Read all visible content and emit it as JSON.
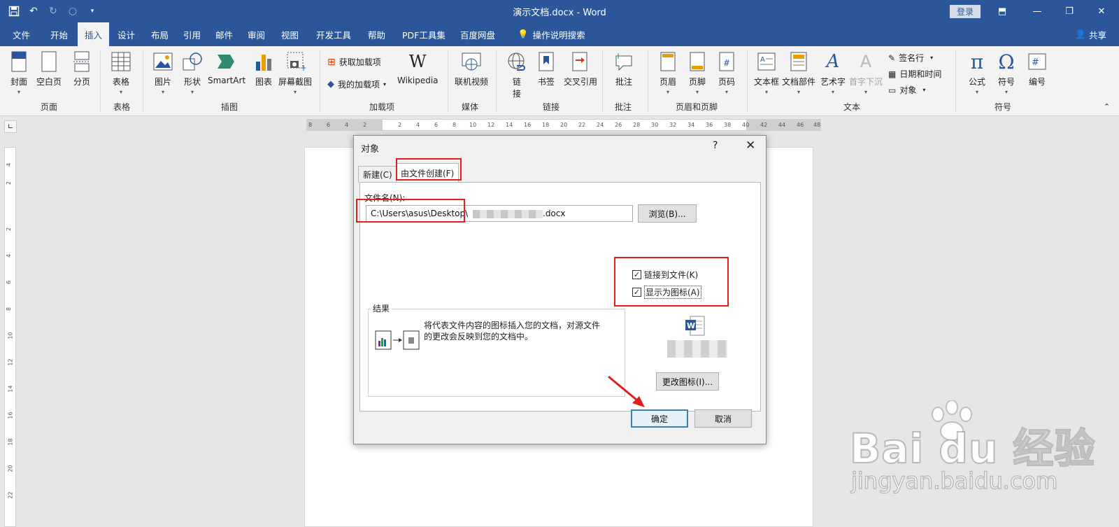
{
  "window": {
    "title": "演示文档.docx - Word",
    "login": "登录",
    "share": "共享"
  },
  "tabs": [
    "文件",
    "开始",
    "插入",
    "设计",
    "布局",
    "引用",
    "邮件",
    "审阅",
    "视图",
    "开发工具",
    "帮助",
    "PDF工具集",
    "百度网盘",
    "操作说明搜索"
  ],
  "active_tab": "插入",
  "ribbon": {
    "page": {
      "cover": "封面",
      "blank": "空白页",
      "break": "分页",
      "group": "页面"
    },
    "table": {
      "table": "表格",
      "group": "表格"
    },
    "illustrations": {
      "picture": "图片",
      "shapes": "形状",
      "smartart": "SmartArt",
      "chart": "图表",
      "screenshot": "屏幕截图",
      "group": "插图"
    },
    "addins": {
      "get": "获取加载项",
      "mine": "我的加载项",
      "wikipedia": "Wikipedia",
      "group": "加载项"
    },
    "media": {
      "online_video": "联机视频",
      "group": "媒体"
    },
    "links": {
      "link_a": "链",
      "link_b": "接",
      "bookmark": "书签",
      "crossref": "交叉引用",
      "group": "链接"
    },
    "comments": {
      "comment": "批注",
      "group": "批注"
    },
    "headerfooter": {
      "header": "页眉",
      "footer": "页脚",
      "pagenum": "页码",
      "group": "页眉和页脚"
    },
    "text": {
      "textbox": "文本框",
      "quickparts": "文档部件",
      "wordart": "艺术字",
      "dropcap": "首字下沉",
      "signature": "签名行",
      "datetime": "日期和时间",
      "object": "对象",
      "group": "文本"
    },
    "symbols": {
      "equation": "公式",
      "symbol": "符号",
      "number": "编号",
      "group": "符号"
    }
  },
  "ruler_h": [
    "8",
    "6",
    "4",
    "2",
    "2",
    "4",
    "6",
    "8",
    "10",
    "12",
    "14",
    "16",
    "18",
    "20",
    "22",
    "24",
    "26",
    "28",
    "30",
    "32",
    "34",
    "36",
    "38",
    "40",
    "42",
    "44",
    "46",
    "48"
  ],
  "ruler_v": [
    "4",
    "2",
    "2",
    "4",
    "6",
    "8",
    "10",
    "12",
    "14",
    "16",
    "18",
    "20",
    "22"
  ],
  "dialog": {
    "title": "对象",
    "help": "?",
    "close": "✕",
    "tab_new": "新建(C)",
    "tab_from_file": "由文件创建(F)",
    "file_label": "文件名(N):",
    "file_value_prefix": "C:\\Users\\asus\\Desktop\\",
    "file_value_suffix": ".docx",
    "browse": "浏览(B)...",
    "link_to_file": "链接到文件(K)",
    "display_as_icon": "显示为图标(A)",
    "link_checked": true,
    "icon_checked": true,
    "result_label": "结果",
    "result_text": "将代表文件内容的图标插入您的文档，对源文件的更改会反映到您的文档中。",
    "change_icon": "更改图标(I)...",
    "ok": "确定",
    "cancel": "取消"
  },
  "watermark": {
    "brand": "Bai du 经验",
    "url": "jingyan.baidu.com"
  },
  "colors": {
    "title_bar": "#2b579a",
    "highlight": "#e0201f",
    "arrow": "#e0201f"
  }
}
